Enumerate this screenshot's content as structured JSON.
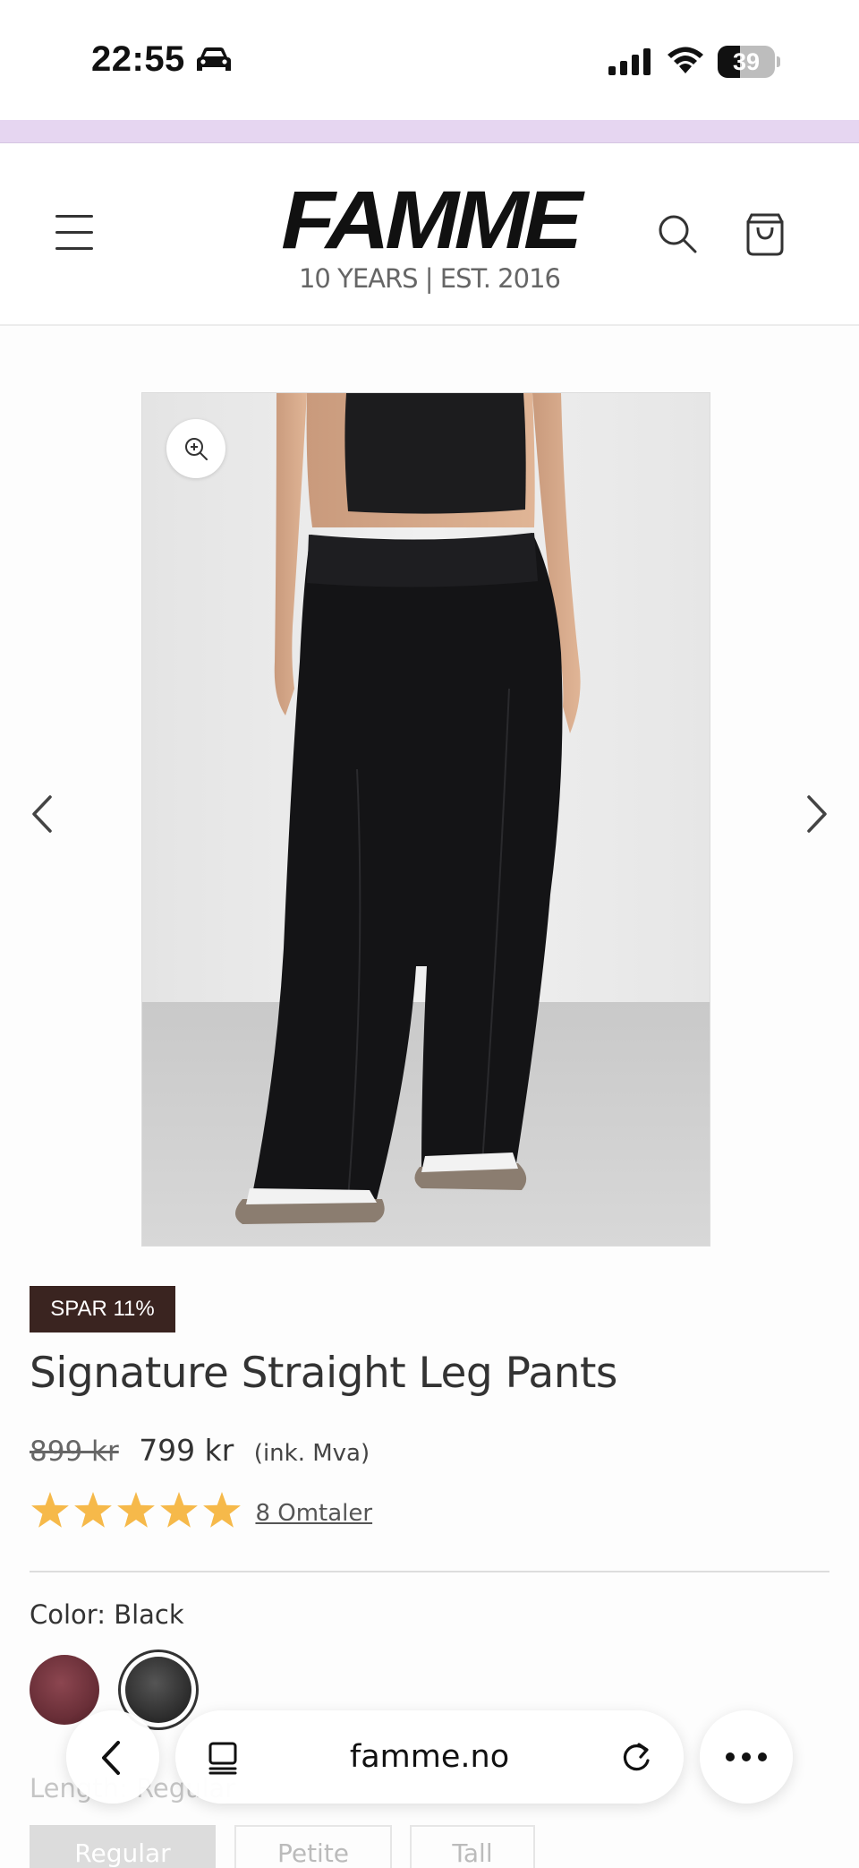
{
  "status_bar": {
    "time": "22:55",
    "battery_percent": 39,
    "battery_label": "39",
    "icons": [
      "car-icon",
      "cellular-signal-icon",
      "wifi-icon",
      "battery-icon"
    ]
  },
  "header": {
    "logo_text": "FAMME",
    "logo_tagline": "10 YEARS |  EST. 2016",
    "icons": [
      "menu-icon",
      "search-icon",
      "cart-icon"
    ]
  },
  "gallery": {
    "image_alt": "Model wearing black Signature Straight Leg Pants with matching black crop top and white sneakers",
    "icons": [
      "zoom-icon",
      "chevron-left-icon",
      "chevron-right-icon"
    ]
  },
  "product": {
    "badge": "SPAR 11%",
    "title": "Signature Straight Leg Pants",
    "price_old": "899 kr",
    "price_new": "799 kr",
    "price_note": "(ink. Mva)",
    "rating": 5,
    "rating_max": 5,
    "reviews_link": "8 Omtaler",
    "color_label": "Color: Black",
    "swatches": [
      {
        "name": "burgundy",
        "color": "#6a2f38",
        "selected": false
      },
      {
        "name": "black",
        "color": "#2a2a2a",
        "selected": true
      }
    ],
    "length_label": "Length: Regular",
    "length_options": [
      {
        "label": "Regular",
        "selected": true
      },
      {
        "label": "Petite",
        "selected": false
      },
      {
        "label": "Tall",
        "selected": false
      }
    ]
  },
  "browser_bar": {
    "url": "famme.no",
    "icons": [
      "chevron-left-icon",
      "tabs-icon",
      "reload-icon",
      "more-icon"
    ]
  },
  "colors": {
    "promo_bar": "#e6d6f1",
    "badge_bg": "#3a2420",
    "star": "#f6b94a"
  }
}
